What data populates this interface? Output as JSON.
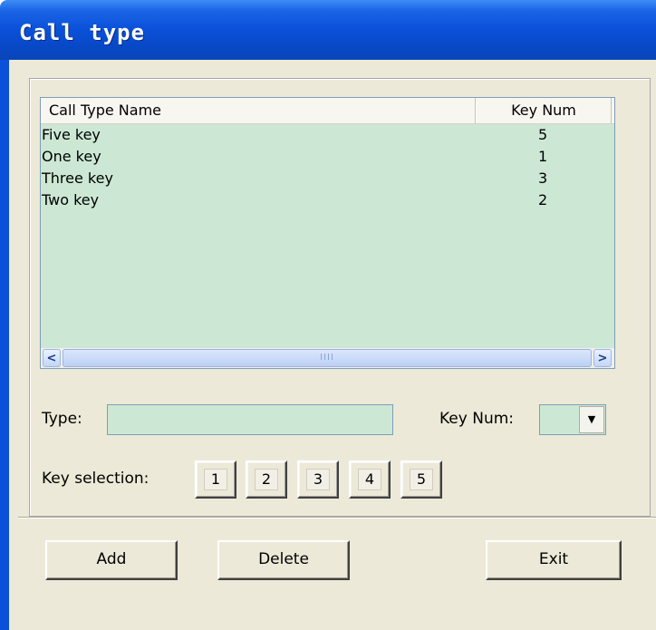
{
  "window": {
    "title": "Call type"
  },
  "listview": {
    "columns": [
      "Call Type Name",
      "Key Num"
    ],
    "rows": [
      {
        "name": "Five  key",
        "key": "5"
      },
      {
        "name": "One key",
        "key": "1"
      },
      {
        "name": "Three  key",
        "key": "3"
      },
      {
        "name": "Two key",
        "key": "2"
      }
    ],
    "scrollbar": {
      "left_arrow": "<",
      "right_arrow": ">",
      "thumb_grip": "IIII"
    }
  },
  "form": {
    "type_label": "Type:",
    "type_value": "",
    "keynum_label": "Key Num:",
    "keynum_value": "",
    "keynum_arrow": "▼",
    "key_selection_label": "Key selection:",
    "keys": [
      "1",
      "2",
      "3",
      "4",
      "5"
    ]
  },
  "buttons": {
    "add": "Add",
    "delete": "Delete",
    "exit": "Exit"
  }
}
